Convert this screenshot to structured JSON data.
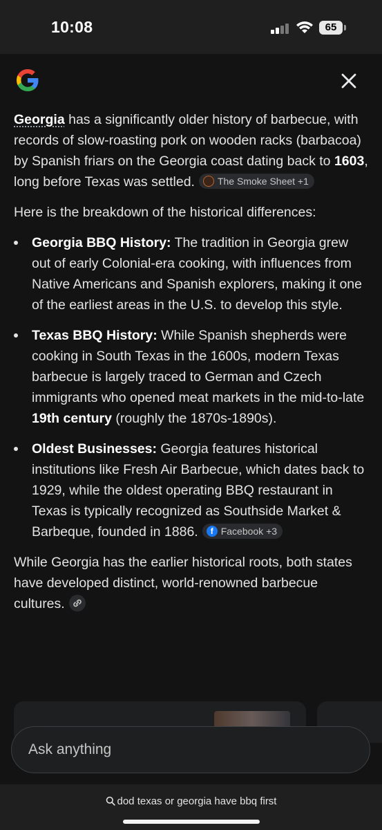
{
  "status": {
    "time": "10:08",
    "battery": "65"
  },
  "answer": {
    "p1": {
      "term": "Georgia",
      "text1": " has a significantly older history of barbecue, with records of slow-roasting pork on wooden racks (barbacoa) by Spanish friars on the Georgia coast dating back to ",
      "year": "1603",
      "text2": ", long before Texas was settled.",
      "chip": "The Smoke Sheet +1"
    },
    "p2": "Here is the breakdown of the historical differences:",
    "bullets": [
      {
        "title": "Georgia BBQ History:",
        "text": " The tradition in Georgia grew out of early Colonial-era cooking, with influences from Native Americans and Spanish explorers, making it one of the earliest areas in the U.S. to develop this style."
      },
      {
        "title": "Texas BBQ History:",
        "text": " While Spanish shepherds were cooking in South Texas in the 1600s, modern Texas barbecue is largely traced to German and Czech immigrants who opened meat markets in the mid-to-late ",
        "bold2": "19th century",
        "text2": " (roughly the 1870s-1890s)."
      },
      {
        "title": "Oldest Businesses:",
        "text": " Georgia features historical institutions like Fresh Air Barbecue, which dates back to 1929, while the oldest operating BBQ restaurant in Texas is typically recognized as Southside Market & Barbeque, founded in 1886.",
        "chip": "Facebook +3"
      }
    ],
    "p3": "While Georgia has the earlier historical roots, both states have developed distinct, world-renowned barbecue cultures."
  },
  "ask": {
    "placeholder": "Ask anything"
  },
  "footer": {
    "query": "dod texas or georgia have bbq first"
  },
  "icons": {
    "close": "close-icon",
    "search": "search-icon",
    "link": "link-icon",
    "logo": "google-logo"
  }
}
